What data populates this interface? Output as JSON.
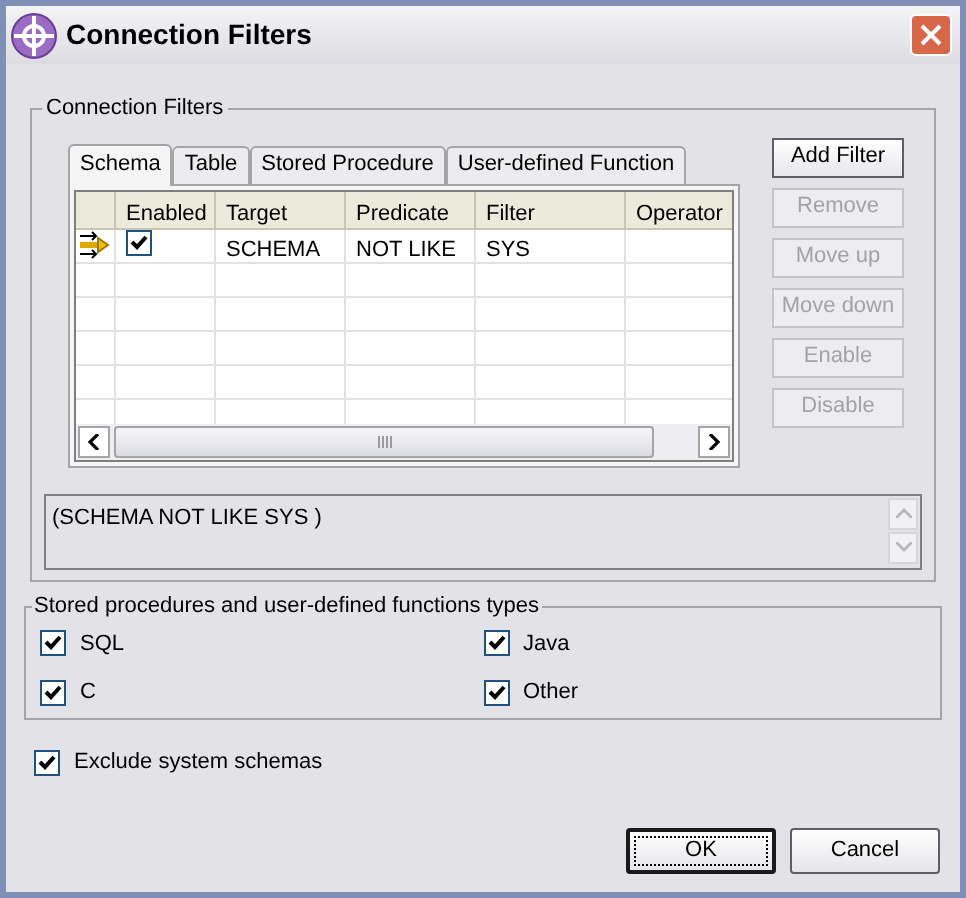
{
  "window": {
    "title": "Connection Filters"
  },
  "filters_group": {
    "title": "Connection Filters",
    "tabs": [
      {
        "label": "Schema",
        "selected": true
      },
      {
        "label": "Table",
        "selected": false
      },
      {
        "label": "Stored Procedure",
        "selected": false
      },
      {
        "label": "User-defined Function",
        "selected": false
      }
    ],
    "table": {
      "columns": [
        "Enabled",
        "Target",
        "Predicate",
        "Filter",
        "Operator"
      ],
      "rows": [
        {
          "enabled": true,
          "cells": [
            "",
            "SCHEMA",
            "NOT LIKE",
            "SYS"
          ]
        }
      ]
    },
    "buttons": [
      {
        "label": "Add Filter",
        "disabled": false
      },
      {
        "label": "Remove",
        "disabled": true
      },
      {
        "label": "Move up",
        "disabled": true
      },
      {
        "label": "Move down",
        "disabled": true
      },
      {
        "label": "Enable",
        "disabled": true
      },
      {
        "label": "Disable",
        "disabled": true
      }
    ],
    "expression": "(SCHEMA NOT LIKE SYS )"
  },
  "types_group": {
    "title": "Stored procedures and user-defined functions types",
    "options": [
      {
        "label": "SQL",
        "checked": true
      },
      {
        "label": "Java",
        "checked": true
      },
      {
        "label": "C",
        "checked": true
      },
      {
        "label": "Other",
        "checked": true
      }
    ]
  },
  "exclude_system_schemas": {
    "label": "Exclude system schemas",
    "checked": true
  },
  "dialog_buttons": [
    {
      "label": "OK",
      "default": true
    },
    {
      "label": "Cancel",
      "default": false
    }
  ]
}
